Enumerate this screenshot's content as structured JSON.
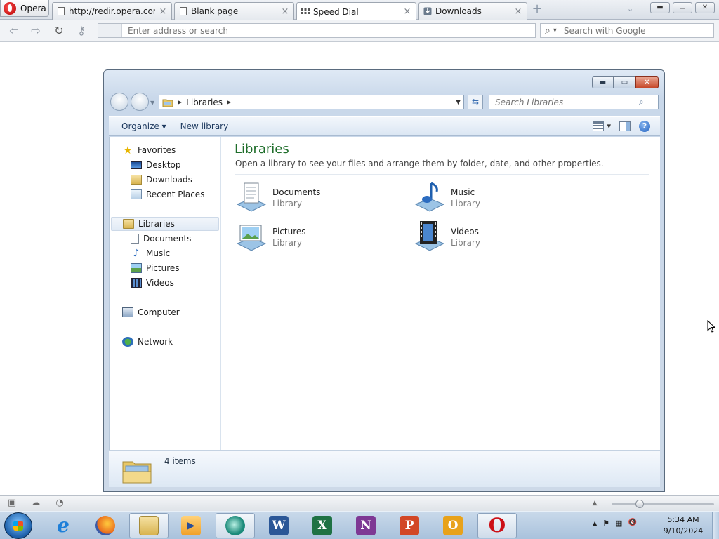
{
  "browser": {
    "menu_label": "Opera",
    "tabs": [
      {
        "title": "http://redir.opera.com...",
        "icon": "page-icon"
      },
      {
        "title": "Blank page",
        "icon": "page-icon"
      },
      {
        "title": "Speed Dial",
        "icon": "grid-icon",
        "active": true
      },
      {
        "title": "Downloads",
        "icon": "download-icon"
      }
    ],
    "close_glyph": "×",
    "new_tab_glyph": "+",
    "tab_menu_glyph": "⌄",
    "window_controls": {
      "minimize": "▬",
      "restore": "❐",
      "close": "✕"
    },
    "nav": {
      "back": "⇦",
      "forward": "⇨",
      "reload": "↻",
      "key": "⚷"
    },
    "address": {
      "value": "",
      "placeholder": "Enter address or search"
    },
    "search": {
      "value": "",
      "placeholder": "Search with Google",
      "glyph": "⌕",
      "arrow": "▾"
    }
  },
  "explorer": {
    "window_controls": {
      "minimize": "▬",
      "maximize": "▭",
      "close": "✕"
    },
    "breadcrumb": {
      "crumb": "Libraries",
      "sep": "▶",
      "drop": "▼"
    },
    "refresh_glyph": "⇆",
    "search": {
      "value": "",
      "placeholder": "Search Libraries",
      "glyph": "⌕"
    },
    "toolbar": {
      "organize": "Organize ▾",
      "new_library": "New library",
      "view_arrow": "▾",
      "help": "?"
    },
    "nav": {
      "favorites": "Favorites",
      "favorites_items": [
        "Desktop",
        "Downloads",
        "Recent Places"
      ],
      "libraries": "Libraries",
      "libraries_items": [
        "Documents",
        "Music",
        "Pictures",
        "Videos"
      ],
      "computer": "Computer",
      "network": "Network"
    },
    "content": {
      "title": "Libraries",
      "subtitle": "Open a library to see your files and arrange them by folder, date, and other properties.",
      "items": [
        {
          "name": "Documents",
          "type": "Library"
        },
        {
          "name": "Music",
          "type": "Library"
        },
        {
          "name": "Pictures",
          "type": "Library"
        },
        {
          "name": "Videos",
          "type": "Library"
        }
      ]
    },
    "status": {
      "count": "4 items"
    }
  },
  "opera_status": {
    "panel": "▣",
    "cloud": "☁",
    "speed": "◔",
    "up": "▲"
  },
  "taskbar": {
    "apps": [
      {
        "name": "internet-explorer",
        "letter": "e",
        "color": "#1e7fd8"
      },
      {
        "name": "firefox",
        "letter": "",
        "color": "#e8681c"
      },
      {
        "name": "windows-explorer",
        "letter": "",
        "color": "#e5b84c"
      },
      {
        "name": "media-player",
        "letter": "▶",
        "color": "#f0a028"
      },
      {
        "name": "media-center",
        "letter": "",
        "color": "#1b8a7a"
      },
      {
        "name": "word",
        "letter": "W",
        "color": "#2b5797"
      },
      {
        "name": "excel",
        "letter": "X",
        "color": "#1f7244"
      },
      {
        "name": "onenote",
        "letter": "N",
        "color": "#7e3894"
      },
      {
        "name": "powerpoint",
        "letter": "P",
        "color": "#d24726"
      },
      {
        "name": "outlook",
        "letter": "O",
        "color": "#e8a21a"
      },
      {
        "name": "opera",
        "letter": "O",
        "color": "#cc0f16"
      }
    ],
    "tray": {
      "up": "▲",
      "flag": "⚑",
      "network": "▦",
      "volume": "🔇"
    },
    "time": "5:34 AM",
    "date": "9/10/2024"
  }
}
